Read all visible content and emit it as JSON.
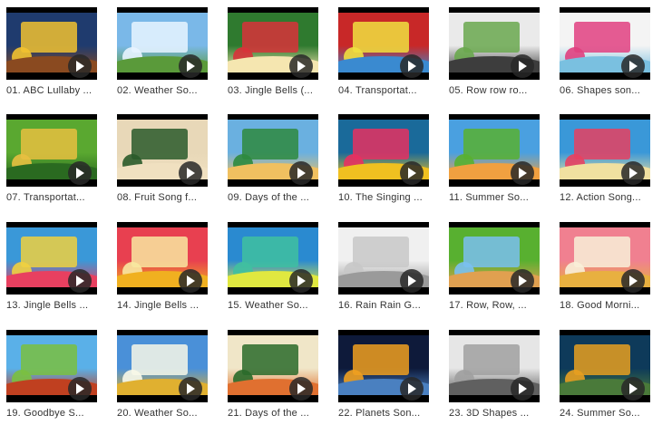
{
  "videos": [
    {
      "title": "01. ABC Lullaby ...",
      "palette": [
        "#1f3b6e",
        "#f2c230",
        "#8a4a20"
      ]
    },
    {
      "title": "02. Weather So...",
      "palette": [
        "#7ab8e8",
        "#e8f4ff",
        "#5a9a3a"
      ]
    },
    {
      "title": "03. Jingle Bells (...",
      "palette": [
        "#2f7a2f",
        "#d8323a",
        "#f5e6b0"
      ]
    },
    {
      "title": "04. Transportat...",
      "palette": [
        "#c82828",
        "#f0e040",
        "#3a8ad0"
      ]
    },
    {
      "title": "05. Row row ro...",
      "palette": [
        "#eaeaea",
        "#6aa84f",
        "#3d3d3d"
      ]
    },
    {
      "title": "06. Shapes son...",
      "palette": [
        "#f4f4f4",
        "#e04080",
        "#7ac0e0"
      ]
    },
    {
      "title": "07. Transportat...",
      "palette": [
        "#5aa830",
        "#e8c040",
        "#2a6a20"
      ]
    },
    {
      "title": "08. Fruit Song f...",
      "palette": [
        "#e8d8b8",
        "#2a5a2a",
        "#f0e0c0"
      ]
    },
    {
      "title": "09. Days of the ...",
      "palette": [
        "#6ab0e0",
        "#2e8a3e",
        "#f0c060"
      ]
    },
    {
      "title": "10. The Singing ...",
      "palette": [
        "#1a6a9a",
        "#e83060",
        "#f0c020"
      ]
    },
    {
      "title": "11. Summer So...",
      "palette": [
        "#4aa0e0",
        "#58b030",
        "#f0a040"
      ]
    },
    {
      "title": "12. Action Song...",
      "palette": [
        "#3a98d8",
        "#e84060",
        "#f0e0a0"
      ]
    },
    {
      "title": "13. Jingle Bells ...",
      "palette": [
        "#3a98d8",
        "#f0d040",
        "#e84060"
      ]
    },
    {
      "title": "14. Jingle Bells ...",
      "palette": [
        "#e84050",
        "#f8e8a0",
        "#f0b020"
      ]
    },
    {
      "title": "15. Weather So...",
      "palette": [
        "#2a8ad0",
        "#40c0a0",
        "#e0e840"
      ]
    },
    {
      "title": "16. Rain Rain G...",
      "palette": [
        "#f0f0f0",
        "#c8c8c8",
        "#9a9a9a"
      ]
    },
    {
      "title": "17. Row, Row, ...",
      "palette": [
        "#58b030",
        "#7ac0f0",
        "#e0a050"
      ]
    },
    {
      "title": "18. Good Morni...",
      "palette": [
        "#f08090",
        "#f8f0d8",
        "#e8b040"
      ]
    },
    {
      "title": "19. Goodbye S...",
      "palette": [
        "#5ab0e8",
        "#7ac040",
        "#c04020"
      ]
    },
    {
      "title": "20. Weather So...",
      "palette": [
        "#4a90d8",
        "#f8f8e8",
        "#e0b030"
      ]
    },
    {
      "title": "21. Days of the ...",
      "palette": [
        "#f0e6c8",
        "#2a6a2a",
        "#e07030"
      ]
    },
    {
      "title": "22. Planets Son...",
      "palette": [
        "#0e1a3a",
        "#f0a020",
        "#4a80c0"
      ]
    },
    {
      "title": "23. 3D Shapes ...",
      "palette": [
        "#e6e6e6",
        "#a0a0a0",
        "#606060"
      ]
    },
    {
      "title": "24. Summer So...",
      "palette": [
        "#0e3a5a",
        "#e8a020",
        "#4a7a3a"
      ]
    }
  ],
  "icons": {
    "play": "play-icon"
  },
  "colors": {
    "thumb_bg": "#000000",
    "play_btn": "#2b2b2b",
    "caption": "#333333"
  }
}
